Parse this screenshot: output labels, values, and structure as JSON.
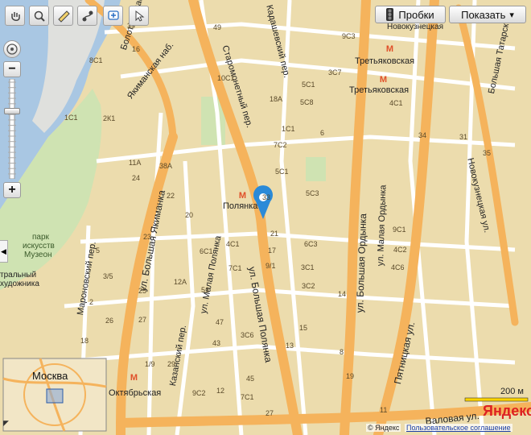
{
  "map": {
    "colors": {
      "block": "#ecdcad",
      "water": "#a9c7e3",
      "park": "#cfe3b2",
      "main_road": "#f5b35c",
      "road": "#ffffff",
      "pin": "#2a8ad8"
    },
    "streets": [
      {
        "text": "Якиманская наб.",
        "key": "yakim_nab"
      },
      {
        "text": "Болотная наб.",
        "key": "bolot_nab"
      },
      {
        "text": "Старомонетный пер.",
        "key": "staromon"
      },
      {
        "text": "Кадашевский пер.",
        "key": "kadash"
      },
      {
        "text": "ул. Большая Якиманка",
        "key": "bya"
      },
      {
        "text": "ул. Большая Полянка",
        "key": "bp"
      },
      {
        "text": "ул. Малая Полянка",
        "key": "mp"
      },
      {
        "text": "ул. Большая Ордынка",
        "key": "bo"
      },
      {
        "text": "ул. Малая Ордынка",
        "key": "mo"
      },
      {
        "text": "Пятницкая ул.",
        "key": "pyat"
      },
      {
        "text": "Новокузнецкая ул.",
        "key": "novokuz"
      },
      {
        "text": "Большая Татарская",
        "key": "btat"
      },
      {
        "text": "Мароновский пер.",
        "key": "maron"
      },
      {
        "text": "Казанский пер.",
        "key": "kazan"
      },
      {
        "text": "Валовая ул.",
        "key": "valov"
      },
      {
        "text": "Новокузнецкая",
        "key": "novokuz_top"
      }
    ],
    "stations": [
      {
        "text": "Третьяковская",
        "key": "tret1"
      },
      {
        "text": "Третьяковская",
        "key": "tret2"
      },
      {
        "text": "Полянка",
        "key": "polyanka"
      },
      {
        "text": "Октябрьская",
        "key": "oktyabr"
      }
    ],
    "poi": {
      "park_line1": "парк",
      "park_line2": "искусств",
      "park_line3": "Музеон",
      "gallery_line1": "тральный",
      "gallery_line2": "художника"
    },
    "buildings": [
      "7С2",
      "5С3",
      "7С1",
      "6С3",
      "6С1",
      "1С1",
      "2К1",
      "24",
      "22",
      "20",
      "16",
      "8С1",
      "10С1",
      "9С3",
      "18А",
      "5С8",
      "5С1",
      "3С7",
      "4С1",
      "1С1",
      "6",
      "5С1",
      "33",
      "34",
      "35",
      "31",
      "9С1",
      "4С2",
      "4С6",
      "4С1",
      "3С2",
      "3С1",
      "9/1",
      "13",
      "15",
      "17",
      "21",
      "23",
      "25",
      "27",
      "29",
      "39",
      "43",
      "45",
      "8",
      "9С2",
      "3С6",
      "7С1",
      "5",
      "3/5",
      "12А",
      "1/9",
      "38А",
      "11А",
      "18",
      "26",
      "2",
      "14",
      "19",
      "11",
      "27",
      "12",
      "47",
      "49",
      "51",
      "55",
      "1",
      "10"
    ]
  },
  "toolbar": {
    "probki_label": "Пробки",
    "show_label": "Показать",
    "show_caret": "▾"
  },
  "zoom": {
    "plus": "+",
    "minus": "−",
    "level_fraction": 0.69
  },
  "minimap": {
    "label": "Москва"
  },
  "scale": {
    "label": "200 м"
  },
  "brand": {
    "logo": "Яндекс"
  },
  "footer": {
    "copyright": "© Яндекс",
    "agreement": "Пользовательское соглашение"
  }
}
